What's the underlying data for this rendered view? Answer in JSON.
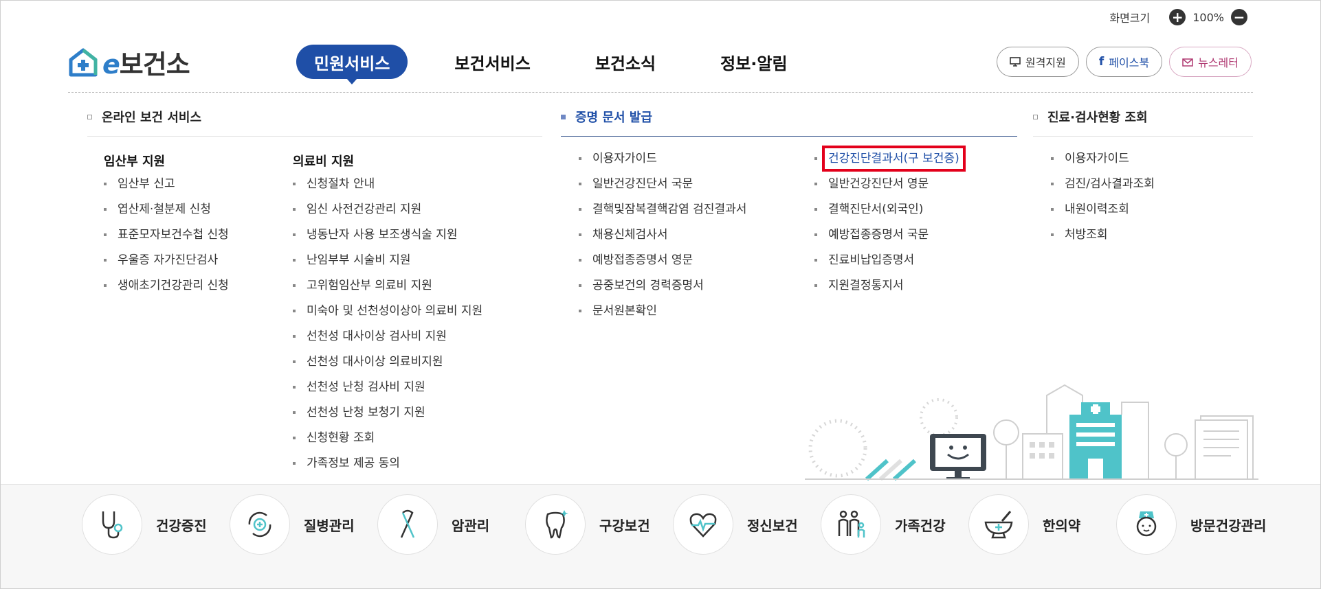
{
  "zoom": {
    "label": "화면크기",
    "value": "100%",
    "plus": "+",
    "minus": "−"
  },
  "logo": {
    "e": "e",
    "name": "보건소"
  },
  "gnb": [
    "민원서비스",
    "보건서비스",
    "보건소식",
    "정보·알림"
  ],
  "util": {
    "remote": "원격지원",
    "facebook": "페이스북",
    "newsletter": "뉴스레터"
  },
  "menu": {
    "online": {
      "title": "온라인 보건 서비스",
      "groups": [
        {
          "title": "임산부 지원",
          "items": [
            "임산부 신고",
            "엽산제·철분제 신청",
            "표준모자보건수첩 신청",
            "우울증 자가진단검사",
            "생애초기건강관리 신청"
          ]
        },
        {
          "title": "의료비 지원",
          "items": [
            "신청절차 안내",
            "임신 사전건강관리 지원",
            "냉동난자 사용 보조생식술 지원",
            "난임부부 시술비 지원",
            "고위험임산부 의료비 지원",
            "미숙아 및 선천성이상아 의료비 지원",
            "선천성 대사이상 검사비 지원",
            "선천성 대사이상 의료비지원",
            "선천성 난청 검사비 지원",
            "선천성 난청 보청기 지원",
            "신청현황 조회",
            "가족정보 제공 동의"
          ]
        }
      ]
    },
    "cert": {
      "title": "증명 문서 발급",
      "col1": [
        "이용자가이드",
        "일반건강진단서 국문",
        "결핵및잠복결핵감염 검진결과서",
        "채용신체검사서",
        "예방접종증명서 영문",
        "공중보건의 경력증명서",
        "문서원본확인"
      ],
      "col2": [
        "건강진단결과서(구 보건증)",
        "일반건강진단서 영문",
        "결핵진단서(외국인)",
        "예방접종증명서 국문",
        "진료비납입증명서",
        "지원결정통지서"
      ]
    },
    "inquiry": {
      "title": "진료·검사현황 조회",
      "items": [
        "이용자가이드",
        "검진/검사결과조회",
        "내원이력조회",
        "처방조회"
      ]
    }
  },
  "bottom": [
    {
      "label": "건강증진",
      "icon": "stethoscope-icon"
    },
    {
      "label": "질병관리",
      "icon": "disease-care-icon"
    },
    {
      "label": "암관리",
      "icon": "cancer-ribbon-icon"
    },
    {
      "label": "구강보건",
      "icon": "tooth-icon"
    },
    {
      "label": "정신보건",
      "icon": "heart-pulse-icon"
    },
    {
      "label": "가족건강",
      "icon": "family-icon"
    },
    {
      "label": "한의약",
      "icon": "mortar-bowl-icon"
    },
    {
      "label": "방문건강관리",
      "icon": "nurse-icon"
    }
  ],
  "colors": {
    "primary": "#1f4fa7",
    "accent": "#4fc3c9",
    "highlight": "#e3001b"
  }
}
